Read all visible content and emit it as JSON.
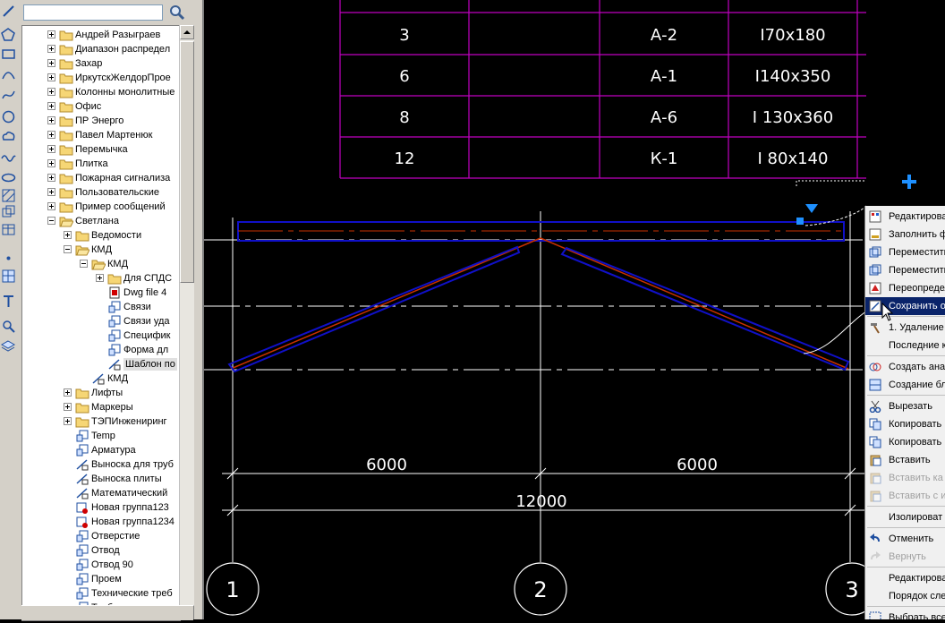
{
  "search": {
    "value": "",
    "placeholder": ""
  },
  "tree": [
    {
      "label": "Андрей Разыграев",
      "level": 0,
      "expander": "plus",
      "icon": "folder-icon"
    },
    {
      "label": "Диапазон распредел",
      "level": 0,
      "expander": "plus",
      "icon": "folder-icon"
    },
    {
      "label": "Захар",
      "level": 0,
      "expander": "plus",
      "icon": "folder-icon"
    },
    {
      "label": "ИркутскЖелдорПрое",
      "level": 0,
      "expander": "plus",
      "icon": "folder-icon"
    },
    {
      "label": "Колонны монолитные",
      "level": 0,
      "expander": "plus",
      "icon": "folder-icon"
    },
    {
      "label": "Офис",
      "level": 0,
      "expander": "plus",
      "icon": "folder-icon"
    },
    {
      "label": "ПР Энерго",
      "level": 0,
      "expander": "plus",
      "icon": "folder-icon"
    },
    {
      "label": "Павел Мартенюк",
      "level": 0,
      "expander": "plus",
      "icon": "folder-icon"
    },
    {
      "label": "Перемычка",
      "level": 0,
      "expander": "plus",
      "icon": "folder-icon"
    },
    {
      "label": "Плитка",
      "level": 0,
      "expander": "plus",
      "icon": "folder-icon"
    },
    {
      "label": "Пожарная сигнализа",
      "level": 0,
      "expander": "plus",
      "icon": "folder-icon"
    },
    {
      "label": "Пользовательские",
      "level": 0,
      "expander": "plus",
      "icon": "folder-icon"
    },
    {
      "label": "Пример сообщений",
      "level": 0,
      "expander": "plus",
      "icon": "folder-icon"
    },
    {
      "label": "Светлана",
      "level": 0,
      "expander": "minus",
      "icon": "folder-open-icon"
    },
    {
      "label": "Ведомости",
      "level": 1,
      "expander": "plus",
      "icon": "folder-icon"
    },
    {
      "label": "КМД",
      "level": 1,
      "expander": "minus",
      "icon": "folder-open-icon"
    },
    {
      "label": "КМД",
      "level": 2,
      "expander": "minus",
      "icon": "folder-open-icon"
    },
    {
      "label": "Для СПДС",
      "level": 3,
      "expander": "plus",
      "icon": "folder-icon"
    },
    {
      "label": "Dwg file 4",
      "level": 3,
      "expander": "",
      "icon": "dwg-file-icon"
    },
    {
      "label": "Связи",
      "level": 3,
      "expander": "",
      "icon": "template-icon"
    },
    {
      "label": "Связи уда",
      "level": 3,
      "expander": "",
      "icon": "template-icon"
    },
    {
      "label": "Специфик",
      "level": 3,
      "expander": "",
      "icon": "template-icon"
    },
    {
      "label": "Форма дл",
      "level": 3,
      "expander": "",
      "icon": "template-icon"
    },
    {
      "label": "Шаблон по",
      "level": 3,
      "expander": "",
      "icon": "drawing-template-icon",
      "selected": true
    },
    {
      "label": "КМД",
      "level": 2,
      "expander": "",
      "icon": "drawing-template-icon"
    },
    {
      "label": "Лифты",
      "level": 1,
      "expander": "plus",
      "icon": "folder-icon"
    },
    {
      "label": "Маркеры",
      "level": 1,
      "expander": "plus",
      "icon": "folder-icon"
    },
    {
      "label": "ТЭПИнжениринг",
      "level": 1,
      "expander": "plus",
      "icon": "folder-icon"
    },
    {
      "label": "Temp",
      "level": 1,
      "expander": "",
      "icon": "template-icon"
    },
    {
      "label": "Арматура",
      "level": 1,
      "expander": "",
      "icon": "template-icon"
    },
    {
      "label": "Выноска для труб",
      "level": 1,
      "expander": "",
      "icon": "drawing-template-icon"
    },
    {
      "label": "Выноска плиты",
      "level": 1,
      "expander": "",
      "icon": "drawing-template-icon"
    },
    {
      "label": "Математический",
      "level": 1,
      "expander": "",
      "icon": "drawing-template-icon"
    },
    {
      "label": "Новая группа123",
      "level": 1,
      "expander": "",
      "icon": "group-icon"
    },
    {
      "label": "Новая группа1234",
      "level": 1,
      "expander": "",
      "icon": "group-icon"
    },
    {
      "label": "Отверстие",
      "level": 1,
      "expander": "",
      "icon": "template-icon"
    },
    {
      "label": "Отвод",
      "level": 1,
      "expander": "",
      "icon": "template-icon"
    },
    {
      "label": "Отвод 90",
      "level": 1,
      "expander": "",
      "icon": "template-icon"
    },
    {
      "label": "Проем",
      "level": 1,
      "expander": "",
      "icon": "template-icon"
    },
    {
      "label": "Технические треб",
      "level": 1,
      "expander": "",
      "icon": "template-icon"
    },
    {
      "label": "Труба",
      "level": 1,
      "expander": "",
      "icon": "template-icon"
    }
  ],
  "table": {
    "rows": [
      {
        "qty": "3",
        "mark": "А-2",
        "section": "I70x180"
      },
      {
        "qty": "6",
        "mark": "А-1",
        "section": "I140x350"
      },
      {
        "qty": "8",
        "mark": "А-6",
        "section": "I 130x360"
      },
      {
        "qty": "12",
        "mark": "К-1",
        "section": "I 80x140"
      }
    ]
  },
  "dimensions": {
    "left_span": "6000",
    "right_span": "6000",
    "total": "12000"
  },
  "axes": [
    "1",
    "2",
    "3"
  ],
  "context_menu": [
    {
      "label": "Редактирова",
      "icon": "edit-properties-icon",
      "state": "normal"
    },
    {
      "label": "Заполнить ф",
      "icon": "fill-form-icon",
      "state": "normal"
    },
    {
      "label": "Переместить",
      "icon": "move-icon",
      "state": "normal"
    },
    {
      "label": "Переместить",
      "icon": "move-icon",
      "state": "normal"
    },
    {
      "label": "Переопредел",
      "icon": "redefine-icon",
      "state": "normal"
    },
    {
      "label": "Сохранить о",
      "icon": "save-object-icon",
      "state": "highlighted"
    },
    {
      "separator": true
    },
    {
      "label": "1. Удаление",
      "icon": "hammer-icon",
      "state": "normal"
    },
    {
      "label": "Последние к",
      "icon": "",
      "state": "normal"
    },
    {
      "separator": true
    },
    {
      "label": "Создать ана",
      "icon": "create-analog-icon",
      "state": "normal"
    },
    {
      "label": "Создание бл",
      "icon": "create-block-icon",
      "state": "normal"
    },
    {
      "separator": true
    },
    {
      "label": "Вырезать",
      "icon": "cut-icon",
      "state": "normal"
    },
    {
      "label": "Копировать",
      "icon": "copy-icon",
      "state": "normal"
    },
    {
      "label": "Копировать",
      "icon": "copy-icon",
      "state": "normal"
    },
    {
      "label": "Вставить",
      "icon": "paste-icon",
      "state": "normal"
    },
    {
      "label": "Вставить ка",
      "icon": "paste-icon",
      "state": "disabled"
    },
    {
      "label": "Вставить с и",
      "icon": "paste-icon",
      "state": "disabled"
    },
    {
      "separator": true
    },
    {
      "label": "Изолироват",
      "icon": "",
      "state": "normal"
    },
    {
      "separator": true
    },
    {
      "label": "Отменить",
      "icon": "undo-icon",
      "state": "normal"
    },
    {
      "label": "Вернуть",
      "icon": "redo-icon",
      "state": "disabled"
    },
    {
      "separator": true
    },
    {
      "label": "Редактирова",
      "icon": "",
      "state": "normal"
    },
    {
      "label": "Порядок сле",
      "icon": "",
      "state": "normal"
    },
    {
      "separator": true
    },
    {
      "label": "Выбрать все",
      "icon": "select-all-icon",
      "state": "normal"
    }
  ],
  "colors": {
    "canvas_bg": "#000000",
    "table_border": "#c000c0",
    "member_outline": "#1010c8",
    "member_axis": "#c83000",
    "grid_line": "#ffffff",
    "grip": "#1e90ff",
    "menu_highlight": "#0a246a"
  }
}
